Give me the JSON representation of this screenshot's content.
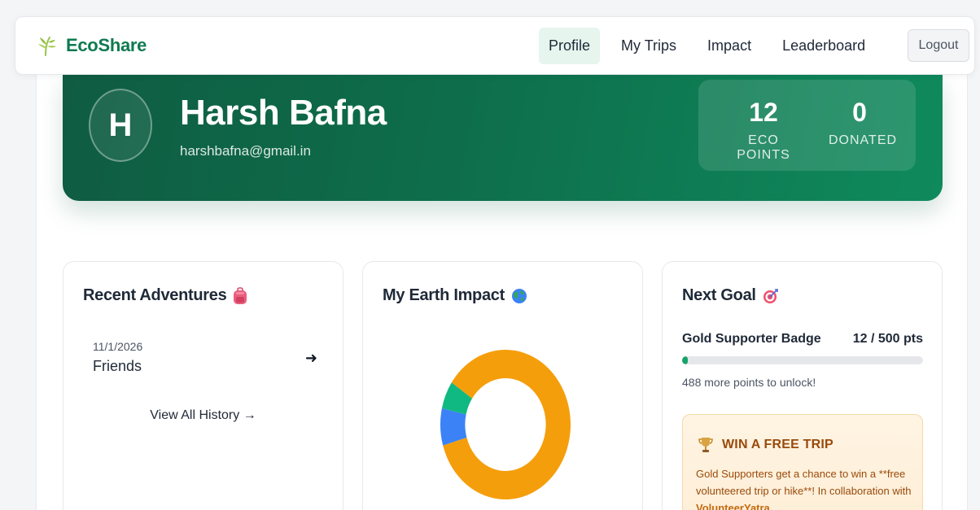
{
  "nav": {
    "brand": "EcoShare",
    "links": [
      "Profile",
      "My Trips",
      "Impact",
      "Leaderboard"
    ],
    "logout_label": "Logout"
  },
  "profile": {
    "initial": "H",
    "name": "Harsh Bafna",
    "email": "harshbafna@gmail.in",
    "stats": {
      "eco_points_value": "12",
      "eco_points_label": "ECO POINTS",
      "donated_value": "0",
      "donated_label": "DONATED"
    }
  },
  "adventures": {
    "title": "Recent Adventures",
    "trips": [
      {
        "date": "11/1/2026",
        "name": "Friends"
      }
    ],
    "view_all_label": "View All History →"
  },
  "impact": {
    "title": "My Earth Impact"
  },
  "goal": {
    "title": "Next Goal",
    "badge_label": "Gold Supporter Badge",
    "progress_text": "12 / 500 pts",
    "progress_fraction": 0.024,
    "hint": "488 more points to unlock!",
    "promo": {
      "title": "WIN A FREE TRIP",
      "text_before_link": "Gold Supporters get a chance to win a **free volunteered trip or hike**! In collaboration with ",
      "link_text": "VolunteerYatra",
      "text_after_link": "."
    }
  },
  "chart_data": {
    "type": "pie",
    "title": "",
    "slices": [
      {
        "value": 0.86,
        "color": "#f59e0b"
      },
      {
        "value": 0.08,
        "color": "#3b82f6"
      },
      {
        "value": 0.06,
        "color": "#10b981"
      }
    ]
  },
  "colors": {
    "brand": "#0f7a4f",
    "hero_start": "#0f5c42",
    "hero_end": "#0f8a5d",
    "progress": "#16a36a",
    "promo_text": "#9a4a0b"
  }
}
